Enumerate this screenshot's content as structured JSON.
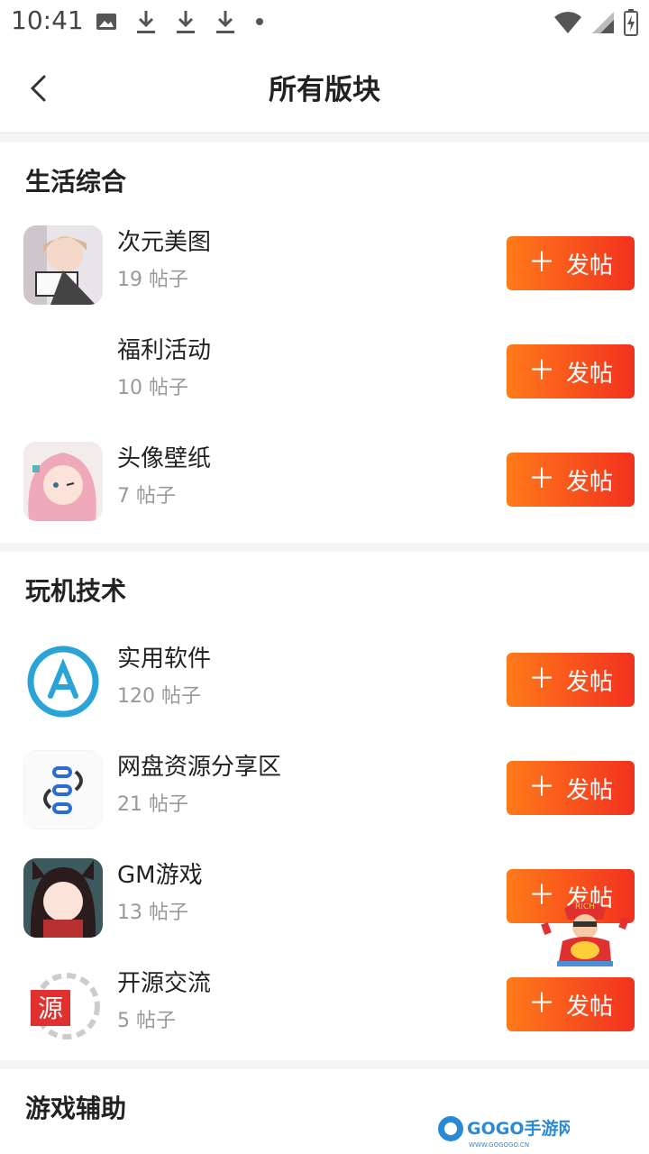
{
  "status": {
    "time": "10:41"
  },
  "header": {
    "title": "所有版块"
  },
  "sections": [
    {
      "title": "生活综合",
      "items": [
        {
          "name": "次元美图",
          "count": "19 帖子",
          "button": "发帖"
        },
        {
          "name": "福利活动",
          "count": "10 帖子",
          "button": "发帖"
        },
        {
          "name": "头像壁纸",
          "count": "7 帖子",
          "button": "发帖"
        }
      ]
    },
    {
      "title": "玩机技术",
      "items": [
        {
          "name": "实用软件",
          "count": "120 帖子",
          "button": "发帖"
        },
        {
          "name": "网盘资源分享区",
          "count": "21 帖子",
          "button": "发帖"
        },
        {
          "name": "GM游戏",
          "count": "13 帖子",
          "button": "发帖"
        },
        {
          "name": "开源交流",
          "count": "5 帖子",
          "button": "发帖"
        }
      ]
    },
    {
      "title": "游戏辅助",
      "items": []
    }
  ],
  "overlay": {
    "mascot_text": "RICH",
    "watermark_text": "GOGO手游网",
    "watermark_sub": "WWW.GOGOGO.CN"
  },
  "colors": {
    "button_start": "#ff7a1a",
    "button_end": "#f2311f",
    "count_gray": "#999999"
  },
  "icons": {
    "back": "chevron-left-icon",
    "plus": "plus-icon"
  }
}
